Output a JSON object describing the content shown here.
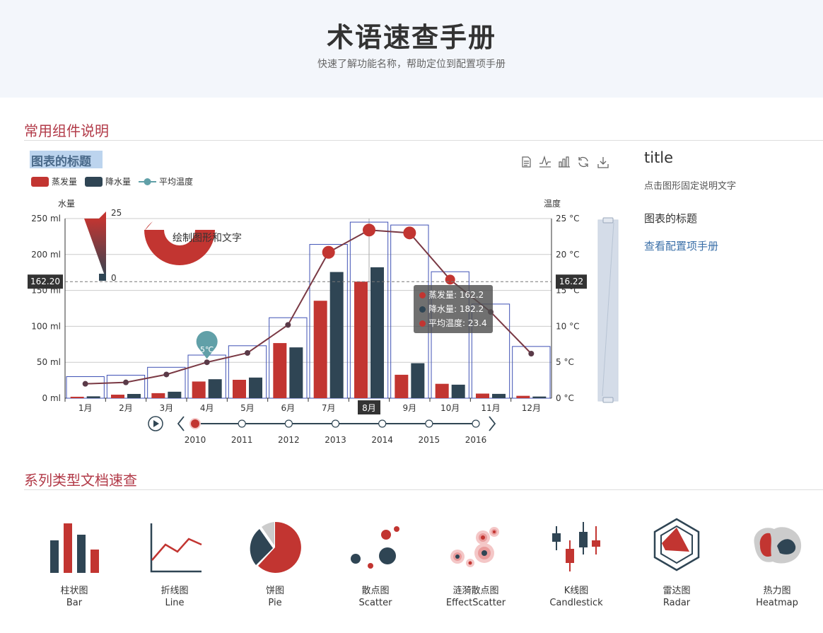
{
  "page": {
    "title": "术语速查手册",
    "subtitle": "快速了解功能名称，帮助定位到配置项手册"
  },
  "sections": {
    "components": "常用组件说明",
    "series": "系列类型文档速查"
  },
  "side": {
    "title": "title",
    "desc": "点击图形固定说明文字",
    "chart_title": "图表的标题",
    "link": "查看配置项手册"
  },
  "tooltip": {
    "rows": [
      {
        "label": "蒸发量: 162.2",
        "color": "#c23531"
      },
      {
        "label": "降水量: 182.2",
        "color": "#2f4554"
      },
      {
        "label": "平均温度: 23.4",
        "color": "#c23531"
      }
    ]
  },
  "graphic": {
    "text": "绘制图形和文字",
    "visual_max": "25",
    "visual_min": "0"
  },
  "timeline": {
    "years": [
      "2010",
      "2011",
      "2012",
      "2013",
      "2014",
      "2015",
      "2016"
    ],
    "current": "2010"
  },
  "marker_label": "5℃",
  "markline": {
    "left": "162.20",
    "right": "16.22"
  },
  "icons": [
    "data-view-icon",
    "line-switch-icon",
    "bar-switch-icon",
    "restore-icon",
    "save-image-icon"
  ],
  "chart_data": {
    "type": "bar",
    "title": "图表的标题",
    "categories": [
      "1月",
      "2月",
      "3月",
      "4月",
      "5月",
      "6月",
      "7月",
      "8月",
      "9月",
      "10月",
      "11月",
      "12月"
    ],
    "selected_category": "8月",
    "ylabel_left": "水量",
    "ylabel_right": "温度",
    "ylim_left": [
      0,
      250
    ],
    "ylim_right": [
      0,
      25
    ],
    "left_ticks": [
      "0 ml",
      "50 ml",
      "100 ml",
      "150 ml",
      "200 ml",
      "250 ml"
    ],
    "right_ticks": [
      "0 °C",
      "5 °C",
      "10 °C",
      "15 °C",
      "20 °C",
      "25 °C"
    ],
    "series": [
      {
        "name": "蒸发量",
        "type": "bar",
        "axis": "left",
        "color": "#c23531",
        "values": [
          2.0,
          4.9,
          7.0,
          23.2,
          25.6,
          76.7,
          135.6,
          162.2,
          32.6,
          20.0,
          6.4,
          3.3
        ]
      },
      {
        "name": "降水量",
        "type": "bar",
        "axis": "left",
        "color": "#2f4554",
        "values": [
          2.6,
          5.9,
          9.0,
          26.4,
          28.7,
          70.7,
          175.6,
          182.2,
          48.7,
          18.8,
          6.0,
          2.3
        ]
      },
      {
        "name": "平均温度",
        "type": "line",
        "axis": "right",
        "color": "#6b3a45",
        "values": [
          2.0,
          2.2,
          3.3,
          5.0,
          6.3,
          10.2,
          20.3,
          23.4,
          23.0,
          16.5,
          12.0,
          6.2
        ]
      }
    ],
    "outline_values": [
      30,
      32,
      43,
      60,
      73,
      112,
      214,
      245,
      241,
      176,
      131,
      72
    ],
    "markline_value": 162.2,
    "grid": true,
    "legend": "top-left"
  },
  "series_types": [
    {
      "zh": "柱状图",
      "en": "Bar",
      "icon": "bar-chart-icon"
    },
    {
      "zh": "折线图",
      "en": "Line",
      "icon": "line-chart-icon"
    },
    {
      "zh": "饼图",
      "en": "Pie",
      "icon": "pie-chart-icon"
    },
    {
      "zh": "散点图",
      "en": "Scatter",
      "icon": "scatter-chart-icon"
    },
    {
      "zh": "涟漪散点图",
      "en": "EffectScatter",
      "icon": "effect-scatter-icon"
    },
    {
      "zh": "K线图",
      "en": "Candlestick",
      "icon": "candlestick-icon"
    },
    {
      "zh": "雷达图",
      "en": "Radar",
      "icon": "radar-chart-icon"
    },
    {
      "zh": "热力图",
      "en": "Heatmap",
      "icon": "heatmap-icon"
    }
  ]
}
